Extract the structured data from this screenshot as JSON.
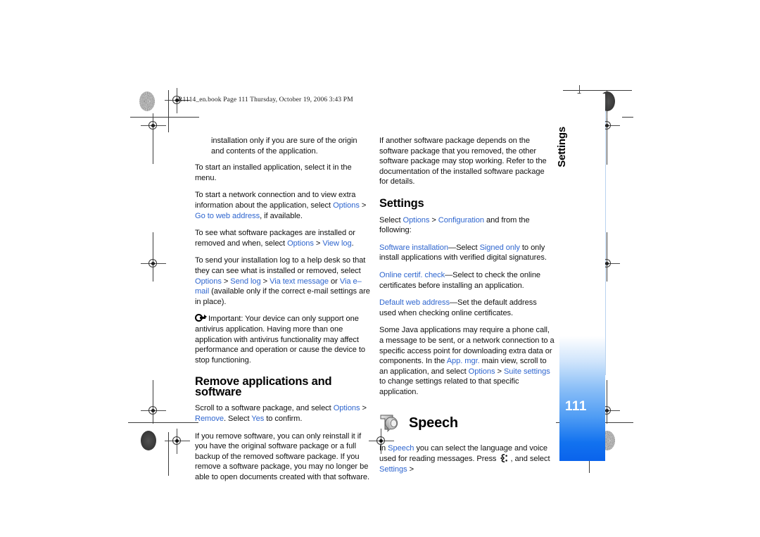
{
  "document": {
    "header_note": "R1114_en.book  Page 111  Thursday, October 19, 2006  3:43 PM",
    "page_number": "111",
    "chapter_title": "Settings"
  },
  "left_column": {
    "paragraphs": [
      {
        "id": "p1",
        "indent": true,
        "runs": [
          {
            "text": "installation only if you are sure of the origin and contents of the application.",
            "style": "normal"
          }
        ]
      },
      {
        "id": "p2",
        "indent": false,
        "runs": [
          {
            "text": "To start an installed application, select it in the menu.",
            "style": "normal"
          }
        ]
      },
      {
        "id": "p3",
        "indent": false,
        "runs": [
          {
            "text": "To start a network connection and to view extra information about the application, select ",
            "style": "normal"
          },
          {
            "text": "Options",
            "style": "link"
          },
          {
            "text": " > ",
            "style": "normal"
          },
          {
            "text": "Go to web address",
            "style": "link"
          },
          {
            "text": ", if available.",
            "style": "normal"
          }
        ]
      },
      {
        "id": "p4",
        "indent": false,
        "runs": [
          {
            "text": "To see what software packages are installed or removed and when, select ",
            "style": "normal"
          },
          {
            "text": "Options",
            "style": "link"
          },
          {
            "text": " > ",
            "style": "normal"
          },
          {
            "text": "View log",
            "style": "link"
          },
          {
            "text": ".",
            "style": "normal"
          }
        ]
      },
      {
        "id": "p5",
        "indent": false,
        "runs": [
          {
            "text": "To send your installation log to a help desk so that they can see what is installed or removed, select ",
            "style": "normal"
          },
          {
            "text": "Options",
            "style": "link"
          },
          {
            "text": " > ",
            "style": "normal"
          },
          {
            "text": "Send log",
            "style": "link"
          },
          {
            "text": " > ",
            "style": "normal"
          },
          {
            "text": "Via text message",
            "style": "link"
          },
          {
            "text": " or ",
            "style": "normal"
          },
          {
            "text": "Via e–mail",
            "style": "link"
          },
          {
            "text": " (available only if the correct e-mail settings are in place).",
            "style": "normal"
          }
        ]
      }
    ],
    "important_note": {
      "icon": "important-arrow-icon",
      "text": "Important: Your device can only support one antivirus application. Having more than one application with antivirus functionality may affect performance and operation or cause the device to stop functioning."
    },
    "heading": "Remove applications and software",
    "paragraphs_after_heading": [
      {
        "id": "p6",
        "indent": false,
        "runs": [
          {
            "text": "Scroll to a software package, and select ",
            "style": "normal"
          },
          {
            "text": "Options",
            "style": "link"
          },
          {
            "text": " > ",
            "style": "normal"
          },
          {
            "text": "Remove",
            "style": "link"
          },
          {
            "text": ". Select ",
            "style": "normal"
          },
          {
            "text": "Yes",
            "style": "link"
          },
          {
            "text": " to confirm.",
            "style": "normal"
          }
        ]
      },
      {
        "id": "p7",
        "indent": false,
        "runs": [
          {
            "text": "If you remove software, you can only reinstall it if you have the original software package or a full backup of the removed software package. If you remove a software package, you may no longer be able to open documents created with that software.",
            "style": "normal"
          }
        ]
      }
    ]
  },
  "right_column": {
    "paragraphs_top": [
      {
        "id": "r1",
        "runs": [
          {
            "text": "If another software package depends on the software package that you removed, the other software package may stop working. Refer to the documentation of the installed software package for details.",
            "style": "normal"
          }
        ]
      }
    ],
    "settings_heading": "Settings",
    "settings_paragraphs": [
      {
        "id": "r2",
        "runs": [
          {
            "text": "Select ",
            "style": "normal"
          },
          {
            "text": "Options",
            "style": "link"
          },
          {
            "text": " > ",
            "style": "normal"
          },
          {
            "text": "Configuration",
            "style": "link"
          },
          {
            "text": " and from the following:",
            "style": "normal"
          }
        ]
      },
      {
        "id": "r3",
        "runs": [
          {
            "text": "Software installation",
            "style": "link"
          },
          {
            "text": "—Select ",
            "style": "normal"
          },
          {
            "text": "Signed only",
            "style": "link"
          },
          {
            "text": " to only install applications with verified digital signatures.",
            "style": "normal"
          }
        ]
      },
      {
        "id": "r4",
        "runs": [
          {
            "text": "Online certif. check",
            "style": "link"
          },
          {
            "text": "—Select to check the online certificates before installing an application.",
            "style": "normal"
          }
        ]
      },
      {
        "id": "r5",
        "runs": [
          {
            "text": "Default web address",
            "style": "link"
          },
          {
            "text": "—Set the default address used when checking online certificates.",
            "style": "normal"
          }
        ]
      },
      {
        "id": "r6",
        "runs": [
          {
            "text": "Some Java applications may require a phone call, a message to be sent, or a network connection to a specific access point for downloading extra data or components. In the ",
            "style": "normal"
          },
          {
            "text": "App. mgr.",
            "style": "link"
          },
          {
            "text": " main view, scroll to an application, and select ",
            "style": "normal"
          },
          {
            "text": "Options",
            "style": "link"
          },
          {
            "text": " > ",
            "style": "normal"
          },
          {
            "text": "Suite settings",
            "style": "link"
          },
          {
            "text": " to change settings related to that specific application.",
            "style": "normal"
          }
        ]
      }
    ],
    "speech_section": {
      "icon": "speech-text-to-speech-icon",
      "heading": "Speech",
      "paragraph": {
        "id": "r7",
        "runs": [
          {
            "text": "In ",
            "style": "normal"
          },
          {
            "text": "Speech",
            "style": "link"
          },
          {
            "text": " you can select the language and voice used for reading messages. Press ",
            "style": "normal"
          },
          {
            "text": " ",
            "style": "keyglyph"
          },
          {
            "text": ", and select ",
            "style": "normal"
          },
          {
            "text": "Settings",
            "style": "link"
          },
          {
            "text": " >",
            "style": "normal"
          }
        ]
      }
    }
  },
  "colors": {
    "link_blue": "#2f66cf",
    "tab_blue_dark": "#0a63ec",
    "tab_blue_mid": "#4f9cf4",
    "text_black": "#111111",
    "page_number_color": "#ffffff"
  },
  "prepress_marks": {
    "registration_mark_name": "registration-crosshair-mark",
    "blob_mark_name": "ink-density-blob-mark",
    "count": 8
  }
}
